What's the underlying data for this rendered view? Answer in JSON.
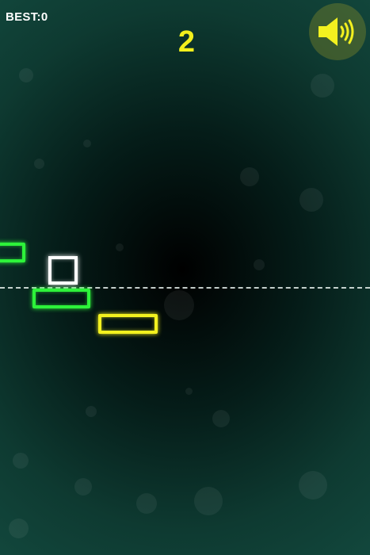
{
  "hud": {
    "best_text": "BEST:0",
    "score": "2"
  },
  "sound_button": {
    "icon": "speaker-volume-icon",
    "state": "on"
  },
  "colors": {
    "score": "#f2ef1c",
    "green_platform": "#2df23a",
    "yellow_platform": "#f3f11f",
    "player": "#ffffff",
    "background_edge": "#134a3f",
    "background_center": "#000000"
  }
}
